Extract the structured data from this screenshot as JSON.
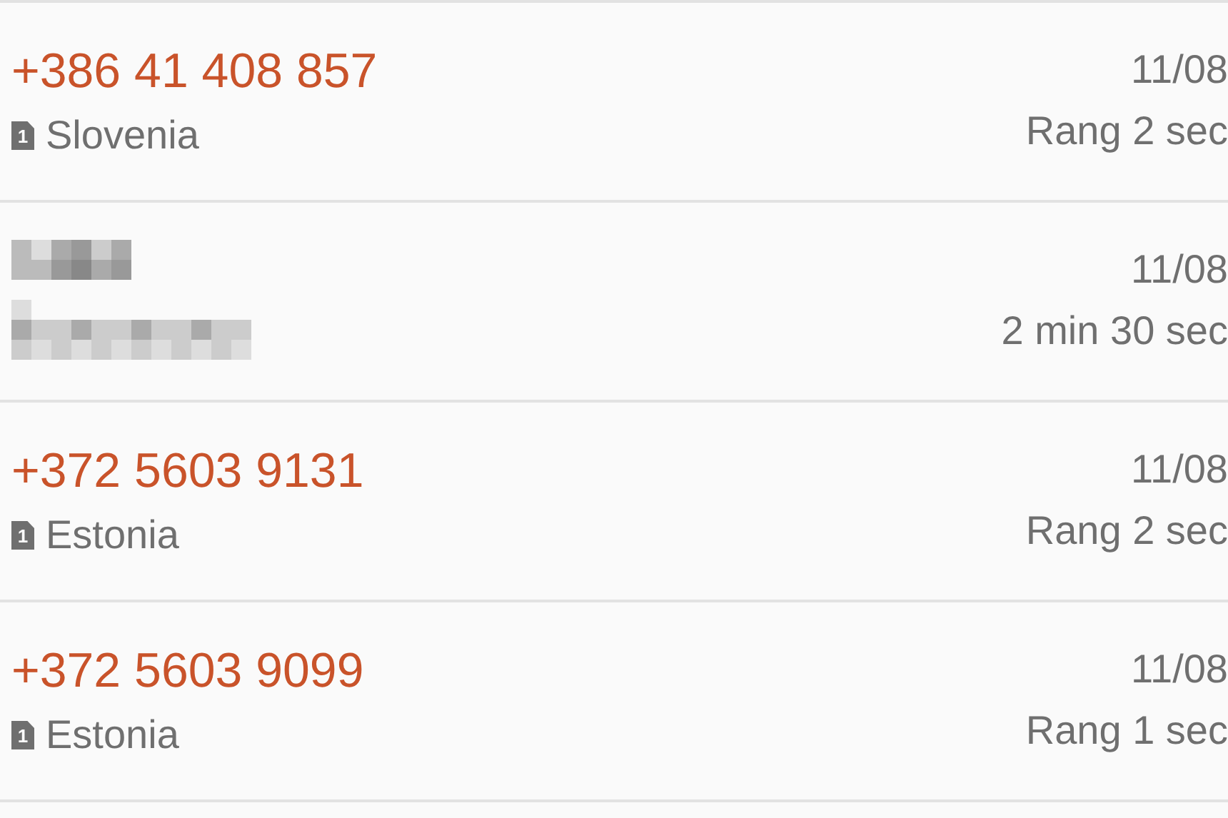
{
  "calls": [
    {
      "kind": "number",
      "number": "+386 41 408 857",
      "sim": "1",
      "country": "Slovenia",
      "date": "11/08",
      "duration": "Rang 2 sec"
    },
    {
      "kind": "redacted",
      "date": "11/08",
      "duration": "2 min 30 sec"
    },
    {
      "kind": "number",
      "number": "+372 5603 9131",
      "sim": "1",
      "country": "Estonia",
      "date": "11/08",
      "duration": "Rang 2 sec"
    },
    {
      "kind": "number",
      "number": "+372 5603 9099",
      "sim": "1",
      "country": "Estonia",
      "date": "11/08",
      "duration": "Rang 1 sec"
    }
  ]
}
